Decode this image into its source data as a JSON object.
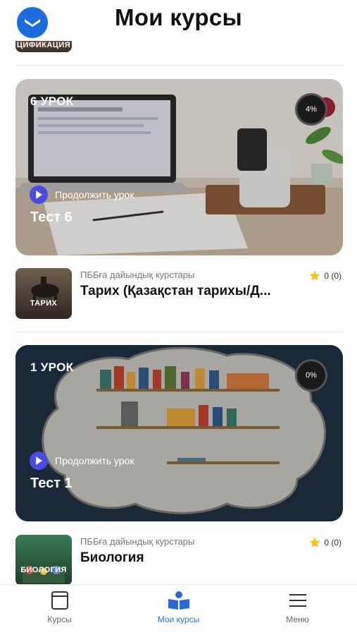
{
  "header": {
    "title": "Мои курсы"
  },
  "top_partial": {
    "thumb_label": "ЦИФИКАЦИЯ"
  },
  "cards": [
    {
      "lesson_count": "6 УРОК",
      "progress": "4%",
      "continue_label": "Продолжить урок",
      "title": "Тест 6"
    },
    {
      "lesson_count": "1 УРОК",
      "progress": "0%",
      "continue_label": "Продолжить урок",
      "title": "Тест 1"
    }
  ],
  "courses": [
    {
      "thumb_label": "ТАРИХ",
      "provider": "ПББға дайындық курстары",
      "name": "Тарих (Қазақстан тарихы/Д...",
      "rating": "0 (0)"
    },
    {
      "thumb_label": "БИОЛОГИЯ",
      "provider": "ПББға дайындық курстары",
      "name": "Биология",
      "rating": "0 (0)"
    }
  ],
  "nav": {
    "items": [
      {
        "label": "Курсы",
        "icon": "book-outline-icon",
        "active": false
      },
      {
        "label": "Мои курсы",
        "icon": "open-book-icon",
        "active": true
      },
      {
        "label": "Меню",
        "icon": "hamburger-menu-icon",
        "active": false
      }
    ]
  },
  "colors": {
    "accent": "#2a6ad8",
    "play": "#4a4be0",
    "star": "#f5c518"
  }
}
